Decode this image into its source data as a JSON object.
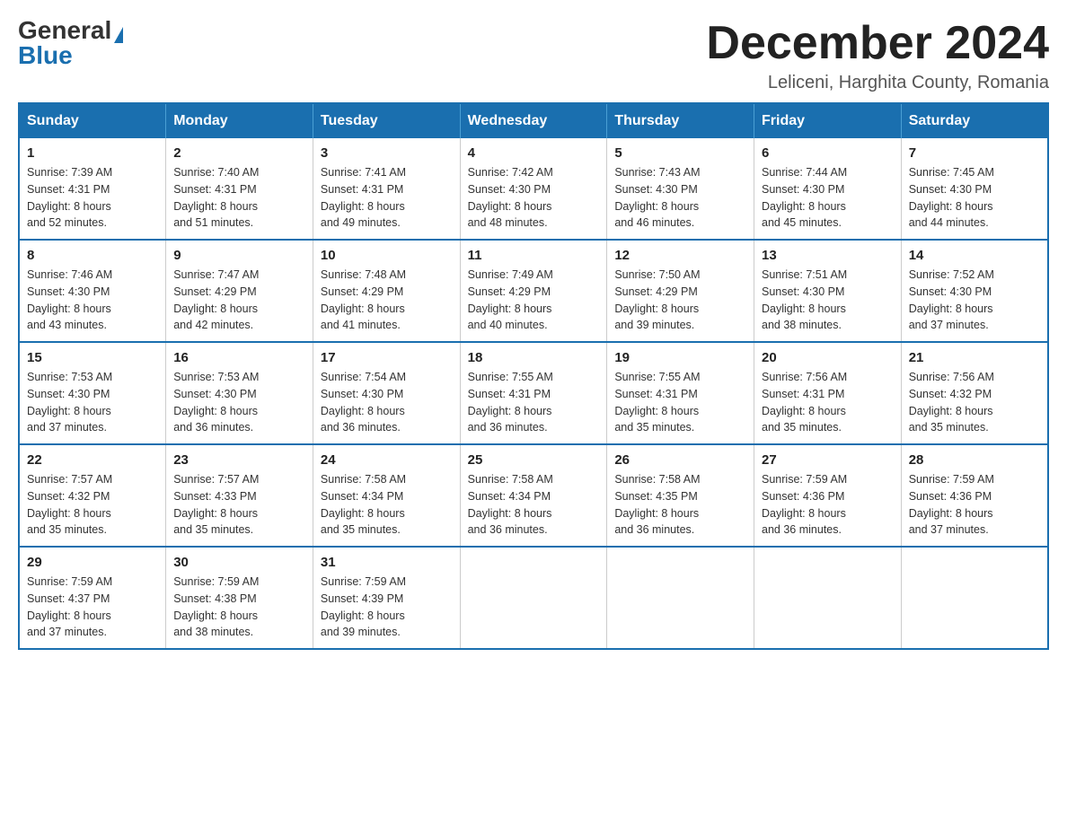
{
  "header": {
    "logo_general": "General",
    "logo_blue": "Blue",
    "month_title": "December 2024",
    "location": "Leliceni, Harghita County, Romania"
  },
  "days_of_week": [
    "Sunday",
    "Monday",
    "Tuesday",
    "Wednesday",
    "Thursday",
    "Friday",
    "Saturday"
  ],
  "weeks": [
    [
      {
        "day": "1",
        "sunrise": "7:39 AM",
        "sunset": "4:31 PM",
        "daylight": "8 hours and 52 minutes."
      },
      {
        "day": "2",
        "sunrise": "7:40 AM",
        "sunset": "4:31 PM",
        "daylight": "8 hours and 51 minutes."
      },
      {
        "day": "3",
        "sunrise": "7:41 AM",
        "sunset": "4:31 PM",
        "daylight": "8 hours and 49 minutes."
      },
      {
        "day": "4",
        "sunrise": "7:42 AM",
        "sunset": "4:30 PM",
        "daylight": "8 hours and 48 minutes."
      },
      {
        "day": "5",
        "sunrise": "7:43 AM",
        "sunset": "4:30 PM",
        "daylight": "8 hours and 46 minutes."
      },
      {
        "day": "6",
        "sunrise": "7:44 AM",
        "sunset": "4:30 PM",
        "daylight": "8 hours and 45 minutes."
      },
      {
        "day": "7",
        "sunrise": "7:45 AM",
        "sunset": "4:30 PM",
        "daylight": "8 hours and 44 minutes."
      }
    ],
    [
      {
        "day": "8",
        "sunrise": "7:46 AM",
        "sunset": "4:30 PM",
        "daylight": "8 hours and 43 minutes."
      },
      {
        "day": "9",
        "sunrise": "7:47 AM",
        "sunset": "4:29 PM",
        "daylight": "8 hours and 42 minutes."
      },
      {
        "day": "10",
        "sunrise": "7:48 AM",
        "sunset": "4:29 PM",
        "daylight": "8 hours and 41 minutes."
      },
      {
        "day": "11",
        "sunrise": "7:49 AM",
        "sunset": "4:29 PM",
        "daylight": "8 hours and 40 minutes."
      },
      {
        "day": "12",
        "sunrise": "7:50 AM",
        "sunset": "4:29 PM",
        "daylight": "8 hours and 39 minutes."
      },
      {
        "day": "13",
        "sunrise": "7:51 AM",
        "sunset": "4:30 PM",
        "daylight": "8 hours and 38 minutes."
      },
      {
        "day": "14",
        "sunrise": "7:52 AM",
        "sunset": "4:30 PM",
        "daylight": "8 hours and 37 minutes."
      }
    ],
    [
      {
        "day": "15",
        "sunrise": "7:53 AM",
        "sunset": "4:30 PM",
        "daylight": "8 hours and 37 minutes."
      },
      {
        "day": "16",
        "sunrise": "7:53 AM",
        "sunset": "4:30 PM",
        "daylight": "8 hours and 36 minutes."
      },
      {
        "day": "17",
        "sunrise": "7:54 AM",
        "sunset": "4:30 PM",
        "daylight": "8 hours and 36 minutes."
      },
      {
        "day": "18",
        "sunrise": "7:55 AM",
        "sunset": "4:31 PM",
        "daylight": "8 hours and 36 minutes."
      },
      {
        "day": "19",
        "sunrise": "7:55 AM",
        "sunset": "4:31 PM",
        "daylight": "8 hours and 35 minutes."
      },
      {
        "day": "20",
        "sunrise": "7:56 AM",
        "sunset": "4:31 PM",
        "daylight": "8 hours and 35 minutes."
      },
      {
        "day": "21",
        "sunrise": "7:56 AM",
        "sunset": "4:32 PM",
        "daylight": "8 hours and 35 minutes."
      }
    ],
    [
      {
        "day": "22",
        "sunrise": "7:57 AM",
        "sunset": "4:32 PM",
        "daylight": "8 hours and 35 minutes."
      },
      {
        "day": "23",
        "sunrise": "7:57 AM",
        "sunset": "4:33 PM",
        "daylight": "8 hours and 35 minutes."
      },
      {
        "day": "24",
        "sunrise": "7:58 AM",
        "sunset": "4:34 PM",
        "daylight": "8 hours and 35 minutes."
      },
      {
        "day": "25",
        "sunrise": "7:58 AM",
        "sunset": "4:34 PM",
        "daylight": "8 hours and 36 minutes."
      },
      {
        "day": "26",
        "sunrise": "7:58 AM",
        "sunset": "4:35 PM",
        "daylight": "8 hours and 36 minutes."
      },
      {
        "day": "27",
        "sunrise": "7:59 AM",
        "sunset": "4:36 PM",
        "daylight": "8 hours and 36 minutes."
      },
      {
        "day": "28",
        "sunrise": "7:59 AM",
        "sunset": "4:36 PM",
        "daylight": "8 hours and 37 minutes."
      }
    ],
    [
      {
        "day": "29",
        "sunrise": "7:59 AM",
        "sunset": "4:37 PM",
        "daylight": "8 hours and 37 minutes."
      },
      {
        "day": "30",
        "sunrise": "7:59 AM",
        "sunset": "4:38 PM",
        "daylight": "8 hours and 38 minutes."
      },
      {
        "day": "31",
        "sunrise": "7:59 AM",
        "sunset": "4:39 PM",
        "daylight": "8 hours and 39 minutes."
      },
      null,
      null,
      null,
      null
    ]
  ],
  "labels": {
    "sunrise": "Sunrise:",
    "sunset": "Sunset:",
    "daylight": "Daylight:"
  }
}
